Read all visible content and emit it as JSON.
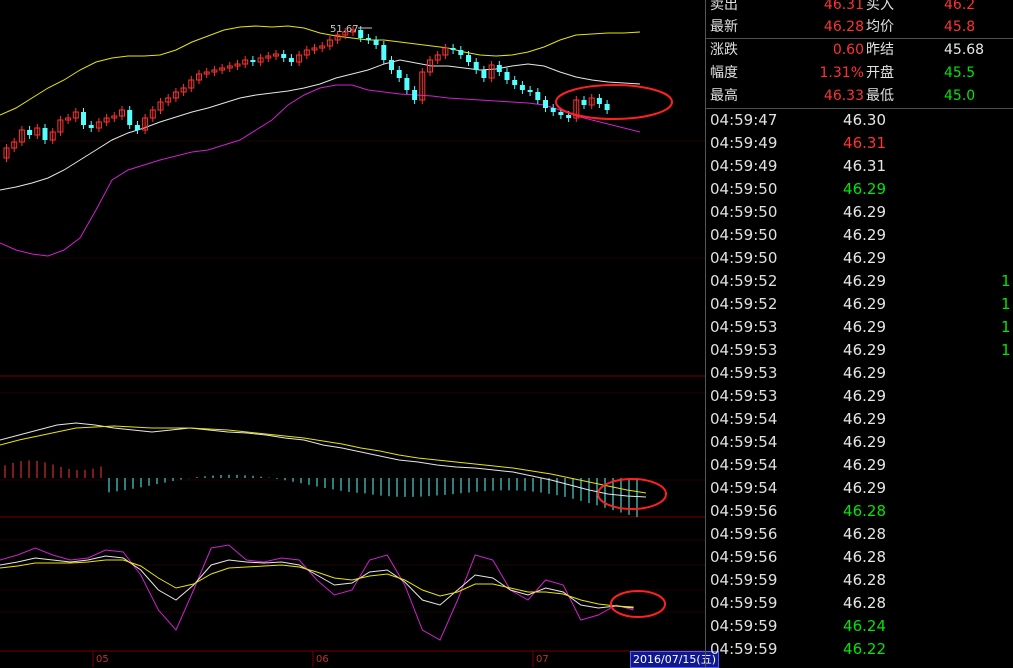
{
  "chart": {
    "high_label": "51.67",
    "month_labels": [
      "05",
      "06",
      "07"
    ],
    "date_tag": "2016/07/15(五)"
  },
  "quote": {
    "rows": [
      {
        "label": "卖出",
        "value": "46.31",
        "value_color": "red",
        "label2": "买入",
        "value2": "46.2",
        "value2_color": "red"
      },
      {
        "label": "最新",
        "value": "46.28",
        "value_color": "red",
        "label2": "均价",
        "value2": "45.8",
        "value2_color": "red"
      },
      {
        "label": "涨跌",
        "value": "0.60",
        "value_color": "red",
        "label2": "昨结",
        "value2": "45.68",
        "value2_color": "white"
      },
      {
        "label": "幅度",
        "value": "1.31%",
        "value_color": "red",
        "label2": "开盘",
        "value2": "45.5",
        "value2_color": "green"
      },
      {
        "label": "最高",
        "value": "46.33",
        "value_color": "red",
        "label2": "最低",
        "value2": "45.0",
        "value2_color": "green"
      }
    ]
  },
  "ticks": [
    {
      "time": "04:59:47",
      "price": "46.30",
      "color": "white",
      "vol": ""
    },
    {
      "time": "04:59:49",
      "price": "46.31",
      "color": "red",
      "vol": ""
    },
    {
      "time": "04:59:49",
      "price": "46.31",
      "color": "white",
      "vol": ""
    },
    {
      "time": "04:59:50",
      "price": "46.29",
      "color": "green",
      "vol": ""
    },
    {
      "time": "04:59:50",
      "price": "46.29",
      "color": "white",
      "vol": ""
    },
    {
      "time": "04:59:50",
      "price": "46.29",
      "color": "white",
      "vol": ""
    },
    {
      "time": "04:59:50",
      "price": "46.29",
      "color": "white",
      "vol": ""
    },
    {
      "time": "04:59:52",
      "price": "46.29",
      "color": "white",
      "vol": "1"
    },
    {
      "time": "04:59:52",
      "price": "46.29",
      "color": "white",
      "vol": "1"
    },
    {
      "time": "04:59:53",
      "price": "46.29",
      "color": "white",
      "vol": "1"
    },
    {
      "time": "04:59:53",
      "price": "46.29",
      "color": "white",
      "vol": "1"
    },
    {
      "time": "04:59:53",
      "price": "46.29",
      "color": "white",
      "vol": ""
    },
    {
      "time": "04:59:53",
      "price": "46.29",
      "color": "white",
      "vol": ""
    },
    {
      "time": "04:59:54",
      "price": "46.29",
      "color": "white",
      "vol": ""
    },
    {
      "time": "04:59:54",
      "price": "46.29",
      "color": "white",
      "vol": ""
    },
    {
      "time": "04:59:54",
      "price": "46.29",
      "color": "white",
      "vol": ""
    },
    {
      "time": "04:59:54",
      "price": "46.29",
      "color": "white",
      "vol": ""
    },
    {
      "time": "04:59:56",
      "price": "46.28",
      "color": "green",
      "vol": ""
    },
    {
      "time": "04:59:56",
      "price": "46.28",
      "color": "white",
      "vol": ""
    },
    {
      "time": "04:59:56",
      "price": "46.28",
      "color": "white",
      "vol": ""
    },
    {
      "time": "04:59:59",
      "price": "46.28",
      "color": "white",
      "vol": ""
    },
    {
      "time": "04:59:59",
      "price": "46.28",
      "color": "white",
      "vol": ""
    },
    {
      "time": "04:59:59",
      "price": "46.24",
      "color": "green",
      "vol": ""
    },
    {
      "time": "04:59:59",
      "price": "46.22",
      "color": "green",
      "vol": ""
    }
  ],
  "colors": {
    "up_candle": "#ff3232",
    "down_candle": "#54ffff",
    "ma_white": "#e6e6e6",
    "band_yellow": "#e6e600",
    "band_magenta": "#d020d0",
    "circle": "#ff2020",
    "grid": "#7a0000"
  }
}
